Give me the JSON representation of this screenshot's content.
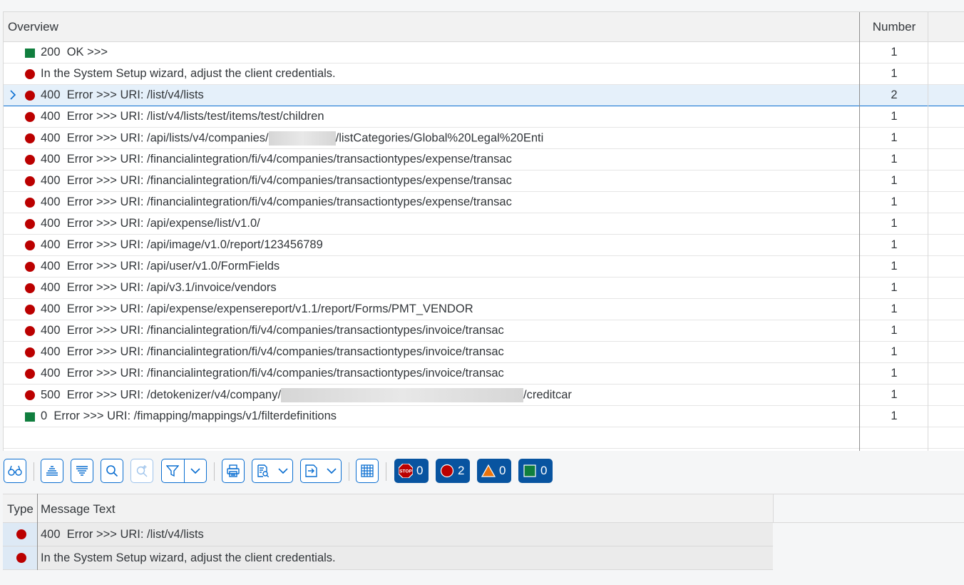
{
  "overview": {
    "columns": {
      "overview": "Overview",
      "number": "Number"
    },
    "rows": [
      {
        "icon": "green-square-icon",
        "status": "green",
        "text": "200  OK >>>",
        "number": "1",
        "expandable": false,
        "selected": false
      },
      {
        "icon": "red-circle-icon",
        "status": "red",
        "text": "In the System Setup wizard, adjust the client credentials.",
        "number": "1",
        "expandable": false,
        "selected": false
      },
      {
        "icon": "red-circle-icon",
        "status": "red",
        "text": "400  Error >>> URI: /list/v4/lists",
        "number": "2",
        "expandable": true,
        "selected": true
      },
      {
        "icon": "red-circle-icon",
        "status": "red",
        "text": "400  Error >>> URI: /list/v4/lists/test/items/test/children",
        "number": "1",
        "expandable": false,
        "selected": false
      },
      {
        "icon": "red-circle-icon",
        "status": "red",
        "text": "400  Error >>> URI: /api/lists/v4/companies/",
        "text_after": "/listCategories/Global%20Legal%20Enti",
        "redacted": "short",
        "number": "1",
        "expandable": false,
        "selected": false
      },
      {
        "icon": "red-circle-icon",
        "status": "red",
        "text": "400  Error >>> URI: /financialintegration/fi/v4/companies/transactiontypes/expense/transac",
        "number": "1",
        "expandable": false,
        "selected": false
      },
      {
        "icon": "red-circle-icon",
        "status": "red",
        "text": "400  Error >>> URI: /financialintegration/fi/v4/companies/transactiontypes/expense/transac",
        "number": "1",
        "expandable": false,
        "selected": false
      },
      {
        "icon": "red-circle-icon",
        "status": "red",
        "text": "400  Error >>> URI: /financialintegration/fi/v4/companies/transactiontypes/expense/transac",
        "number": "1",
        "expandable": false,
        "selected": false
      },
      {
        "icon": "red-circle-icon",
        "status": "red",
        "text": "400  Error >>> URI: /api/expense/list/v1.0/",
        "number": "1",
        "expandable": false,
        "selected": false
      },
      {
        "icon": "red-circle-icon",
        "status": "red",
        "text": "400  Error >>> URI: /api/image/v1.0/report/123456789",
        "number": "1",
        "expandable": false,
        "selected": false
      },
      {
        "icon": "red-circle-icon",
        "status": "red",
        "text": "400  Error >>> URI: /api/user/v1.0/FormFields",
        "number": "1",
        "expandable": false,
        "selected": false
      },
      {
        "icon": "red-circle-icon",
        "status": "red",
        "text": "400  Error >>> URI: /api/v3.1/invoice/vendors",
        "number": "1",
        "expandable": false,
        "selected": false
      },
      {
        "icon": "red-circle-icon",
        "status": "red",
        "text": "400  Error >>> URI: /api/expense/expensereport/v1.1/report/Forms/PMT_VENDOR",
        "number": "1",
        "expandable": false,
        "selected": false
      },
      {
        "icon": "red-circle-icon",
        "status": "red",
        "text": "400  Error >>> URI: /financialintegration/fi/v4/companies/transactiontypes/invoice/transac",
        "number": "1",
        "expandable": false,
        "selected": false
      },
      {
        "icon": "red-circle-icon",
        "status": "red",
        "text": "400  Error >>> URI: /financialintegration/fi/v4/companies/transactiontypes/invoice/transac",
        "number": "1",
        "expandable": false,
        "selected": false
      },
      {
        "icon": "red-circle-icon",
        "status": "red",
        "text": "400  Error >>> URI: /financialintegration/fi/v4/companies/transactiontypes/invoice/transac",
        "number": "1",
        "expandable": false,
        "selected": false
      },
      {
        "icon": "red-circle-icon",
        "status": "red",
        "text": "500  Error >>> URI: /detokenizer/v4/company/",
        "text_after": "/creditcar",
        "redacted": "long",
        "number": "1",
        "expandable": false,
        "selected": false
      },
      {
        "icon": "green-square-icon",
        "status": "green",
        "text": "0  Error >>> URI: /fimapping/mappings/v1/filterdefinitions",
        "number": "1",
        "expandable": false,
        "selected": false
      }
    ]
  },
  "toolbar": {
    "counters": [
      {
        "icon": "stop-icon",
        "value": "0"
      },
      {
        "icon": "error-circle-icon",
        "value": "2"
      },
      {
        "icon": "warning-triangle-icon",
        "value": "0"
      },
      {
        "icon": "success-square-icon",
        "value": "0"
      }
    ],
    "stop_label": "STOP"
  },
  "messages": {
    "columns": {
      "type": "Type",
      "text": "Message Text"
    },
    "rows": [
      {
        "icon": "red-circle-icon",
        "text": "400  Error >>> URI: /list/v4/lists"
      },
      {
        "icon": "red-circle-icon",
        "text": "In the System Setup wizard, adjust the client credentials."
      }
    ]
  },
  "colors": {
    "error": "#bb0000",
    "success": "#107e3e",
    "warning": "#e9730c",
    "accent": "#0a6ed1",
    "badge_bg": "#0854a0",
    "selected_row": "#e5f0fa"
  }
}
